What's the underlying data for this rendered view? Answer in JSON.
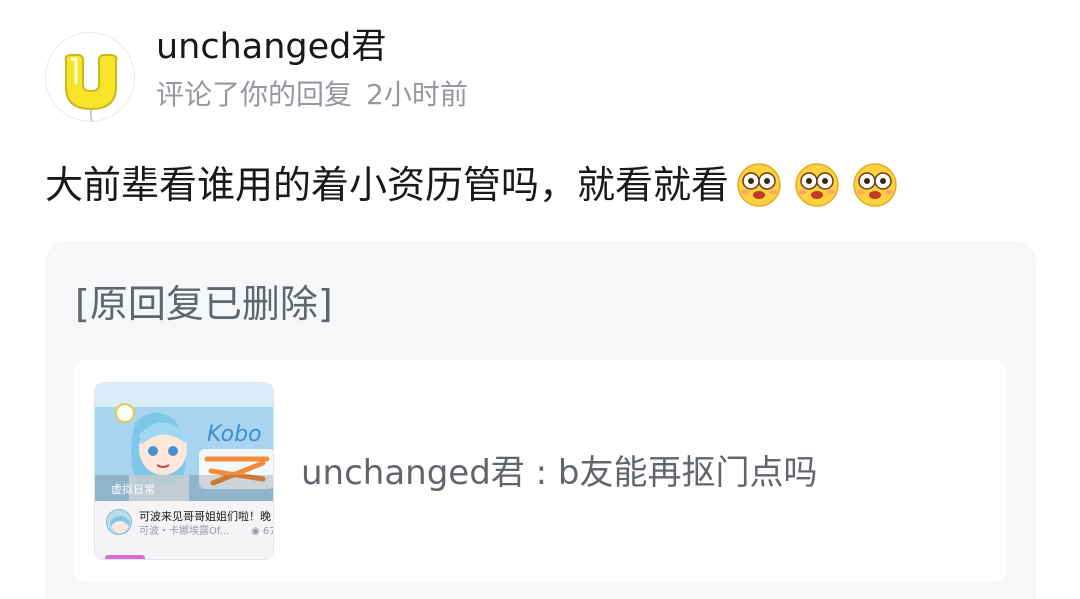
{
  "header": {
    "username": "unchanged君",
    "action": "评论了你的回复",
    "time": "2小时前",
    "avatar_icon": "yellow-balloon-letter-u"
  },
  "comment": {
    "text": "大前辈看谁用的着小资历管吗，就看就看",
    "emojis": [
      "dizzy-eyes-emoji",
      "dizzy-eyes-emoji",
      "dizzy-eyes-emoji"
    ]
  },
  "quote": {
    "deleted_text": "[原回复已删除]",
    "reference": {
      "text": "unchanged君 : b友能再抠门点吗",
      "thumbnail": {
        "banner_text": "Kobo",
        "tag": "虚拟日常",
        "title": "可波来见哥哥姐姐们啦！晚",
        "author": "可波・卡娜埃露Of...",
        "views": "67"
      }
    }
  },
  "colors": {
    "primary_text": "#18191c",
    "secondary_text": "#9499a0",
    "quote_text": "#61666d",
    "quote_bg": "#f6f7f8",
    "card_bg": "#ffffff",
    "avatar_yellow": "#f5e42a"
  }
}
